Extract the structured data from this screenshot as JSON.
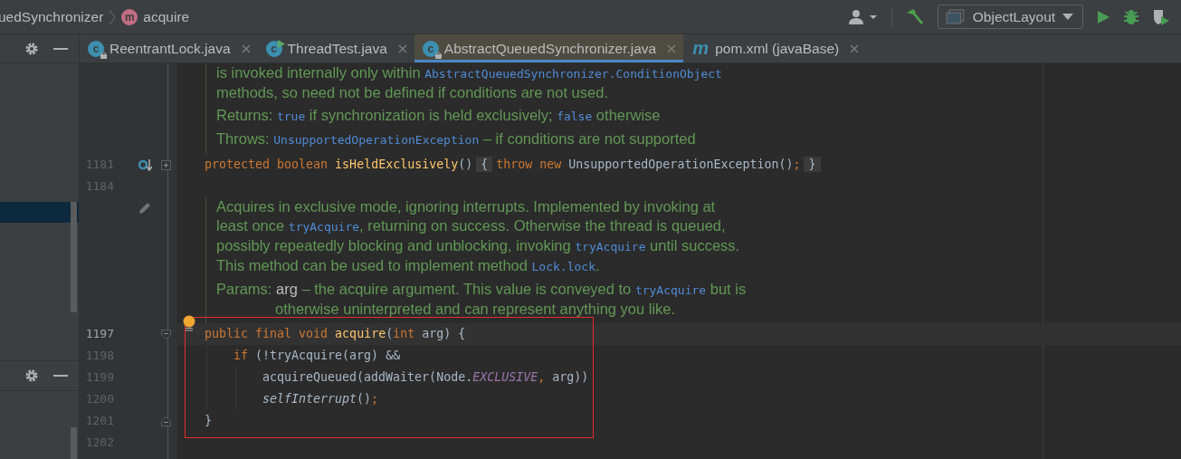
{
  "breadcrumbs": [
    {
      "label": "uedSynchronizer"
    },
    {
      "label": "acquire",
      "icon_letter": "m"
    }
  ],
  "run_config": {
    "label": "ObjectLayout"
  },
  "tabs": [
    {
      "label": "ReentrantLock.java",
      "icon_letter": "c",
      "kind": "locked",
      "selected": false
    },
    {
      "label": "ThreadTest.java",
      "icon_letter": "c",
      "kind": "runnable",
      "selected": false
    },
    {
      "label": "AbstractQueuedSynchronizer.java",
      "icon_letter": "c",
      "kind": "locked",
      "selected": true
    },
    {
      "label": "pom.xml (javaBase)",
      "icon_letter": "m",
      "kind": "maven",
      "selected": false
    }
  ],
  "editor": [
    {
      "kind": "doc",
      "paragraphs": [
        {
          "lines": [
            {
              "segments": [
                {
                  "text": "is invoked internally only within ",
                  "kind": "prose"
                },
                {
                  "text": "AbstractQueuedSynchronizer.ConditionObject",
                  "kind": "code"
                }
              ]
            },
            {
              "segments": [
                {
                  "text": "methods, so need not be defined if conditions are not used.",
                  "kind": "prose"
                }
              ]
            }
          ]
        },
        {
          "lines": [
            {
              "segments": [
                {
                  "text": "Returns: ",
                  "kind": "prose"
                },
                {
                  "text": "true",
                  "kind": "code"
                },
                {
                  "text": " if synchronization is held exclusively; ",
                  "kind": "prose"
                },
                {
                  "text": "false",
                  "kind": "code"
                },
                {
                  "text": " otherwise",
                  "kind": "prose"
                }
              ]
            }
          ]
        },
        {
          "lines": [
            {
              "segments": [
                {
                  "text": "Throws: ",
                  "kind": "prose"
                },
                {
                  "text": "UnsupportedOperationException",
                  "kind": "code"
                },
                {
                  "text": " – if conditions are not supported",
                  "kind": "prose"
                }
              ]
            }
          ]
        }
      ]
    },
    {
      "kind": "code",
      "number": "1181",
      "gutter_icon": {
        "kind": "implements"
      },
      "fold_marker": {
        "kind": "expand"
      },
      "tokens": [
        {
          "text": "protected boolean ",
          "kind": "keyword"
        },
        {
          "text": "isHeldExclusively",
          "kind": "declaration"
        },
        {
          "text": "()",
          "kind": "plain"
        },
        {
          "text": "{",
          "kind": "folded"
        },
        {
          "text": "throw new ",
          "kind": "keyword"
        },
        {
          "text": "UnsupportedOperationException()",
          "kind": "plain"
        },
        {
          "text": ";",
          "kind": "keyword"
        },
        {
          "text": "}",
          "kind": "folded"
        }
      ]
    },
    {
      "kind": "code",
      "number": "1184"
    },
    {
      "kind": "doc",
      "gutter_icon": {
        "kind": "edit"
      },
      "paragraphs": [
        {
          "lines": [
            {
              "segments": [
                {
                  "text": "Acquires in exclusive mode, ignoring interrupts. Implemented by invoking at",
                  "kind": "prose"
                }
              ]
            },
            {
              "segments": [
                {
                  "text": "least once ",
                  "kind": "prose"
                },
                {
                  "text": "tryAcquire",
                  "kind": "code"
                },
                {
                  "text": ", returning on success. Otherwise the thread is queued,",
                  "kind": "prose"
                }
              ]
            },
            {
              "segments": [
                {
                  "text": "possibly repeatedly blocking and unblocking, invoking ",
                  "kind": "prose"
                },
                {
                  "text": "tryAcquire",
                  "kind": "code"
                },
                {
                  "text": " until success.",
                  "kind": "prose"
                }
              ]
            },
            {
              "segments": [
                {
                  "text": "This method can be used to implement method ",
                  "kind": "prose"
                },
                {
                  "text": "Lock.lock",
                  "kind": "code"
                },
                {
                  "text": ".",
                  "kind": "prose"
                }
              ]
            }
          ]
        },
        {
          "lines": [
            {
              "segments": [
                {
                  "text": "Params: ",
                  "kind": "prose"
                },
                {
                  "text": "arg",
                  "kind": "param"
                },
                {
                  "text": " – the acquire argument. This value is conveyed to ",
                  "kind": "prose"
                },
                {
                  "text": "tryAcquire",
                  "kind": "code"
                },
                {
                  "text": " but is",
                  "kind": "prose"
                }
              ]
            },
            {
              "continued": true,
              "segments": [
                {
                  "text": "otherwise uninterpreted and can represent anything you like.",
                  "kind": "prose"
                }
              ]
            }
          ]
        }
      ]
    },
    {
      "kind": "annotated",
      "lines": [
        {
          "kind": "code",
          "number": "1197",
          "current": true,
          "bulb": true,
          "fold_marker": {
            "kind": "start"
          },
          "tokens": [
            {
              "text": "public final void ",
              "kind": "keyword"
            },
            {
              "text": "acquire",
              "kind": "declaration"
            },
            {
              "text": "(",
              "kind": "plain"
            },
            {
              "text": "int ",
              "kind": "keyword"
            },
            {
              "text": "arg) {",
              "kind": "plain"
            }
          ],
          "children": [
            {
              "kind": "code",
              "number": "1198",
              "tokens": [
                {
                  "text": "if ",
                  "kind": "keyword"
                },
                {
                  "text": "(!tryAcquire(arg) &&",
                  "kind": "plain"
                }
              ],
              "children": [
                {
                  "kind": "code",
                  "number": "1199",
                  "tokens": [
                    {
                      "text": "acquireQueued(addWaiter(Node.",
                      "kind": "plain"
                    },
                    {
                      "text": "EXCLUSIVE",
                      "kind": "static"
                    },
                    {
                      "text": ", ",
                      "kind": "keyword"
                    },
                    {
                      "text": "arg))",
                      "kind": "plain"
                    }
                  ]
                },
                {
                  "kind": "code",
                  "number": "1200",
                  "tokens": [
                    {
                      "text": "selfInterrupt",
                      "kind": "italic"
                    },
                    {
                      "text": "()",
                      "kind": "plain"
                    },
                    {
                      "text": ";",
                      "kind": "keyword"
                    }
                  ]
                }
              ]
            }
          ]
        },
        {
          "kind": "code",
          "number": "1201",
          "fold_marker": {
            "kind": "end"
          },
          "tokens": [
            {
              "text": "}",
              "kind": "plain"
            }
          ]
        }
      ]
    },
    {
      "kind": "code",
      "number": "1202"
    }
  ]
}
